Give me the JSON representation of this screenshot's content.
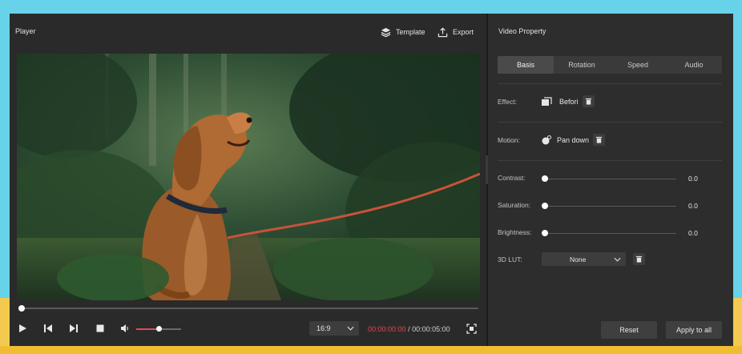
{
  "player": {
    "title": "Player",
    "template_label": "Template",
    "export_label": "Export",
    "seek_progress": 0.0,
    "volume_level": 0.5,
    "aspect_ratio": "16:9",
    "current_time": "00:00:00:00",
    "total_time": "/ 00:00:05:00",
    "accent_color": "#e2495a"
  },
  "props": {
    "title": "Video Property",
    "tabs": [
      "Basis",
      "Rotation",
      "Speed",
      "Audio"
    ],
    "active_tab": "Basis",
    "effect": {
      "label": "Effect:",
      "value": "Befori"
    },
    "motion": {
      "label": "Motion:",
      "value": "Pan down"
    },
    "contrast": {
      "label": "Contrast:",
      "value": "0.0"
    },
    "saturation": {
      "label": "Saturation:",
      "value": "0.0"
    },
    "brightness": {
      "label": "Brightness:",
      "value": "0.0"
    },
    "lut": {
      "label": "3D LUT:",
      "value": "None"
    },
    "reset_label": "Reset",
    "apply_label": "Apply to all"
  }
}
